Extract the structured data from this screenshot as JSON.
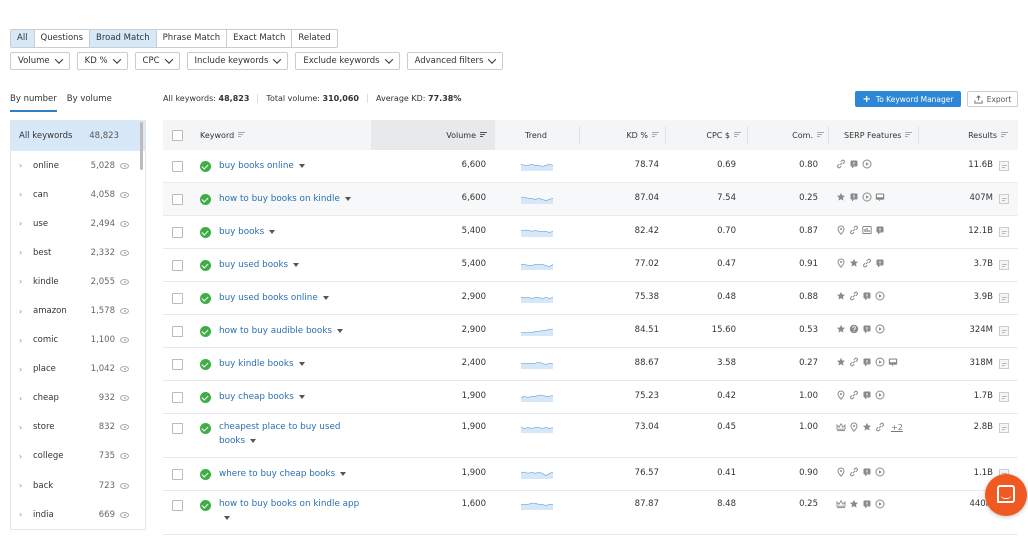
{
  "type_tabs": [
    {
      "label": "All",
      "active": true
    },
    {
      "label": "Questions",
      "active": false
    }
  ],
  "match_tabs": [
    {
      "label": "Broad Match",
      "active": true
    },
    {
      "label": "Phrase Match",
      "active": false
    },
    {
      "label": "Exact Match",
      "active": false
    },
    {
      "label": "Related",
      "active": false
    }
  ],
  "filters": [
    "Volume",
    "KD %",
    "CPC",
    "Include keywords",
    "Exclude keywords",
    "Advanced filters"
  ],
  "sidebar": {
    "tabs": [
      {
        "label": "By number",
        "active": true
      },
      {
        "label": "By volume",
        "active": false
      }
    ],
    "all": {
      "label": "All keywords",
      "count": "48,823"
    },
    "groups": [
      {
        "label": "online",
        "count": "5,028"
      },
      {
        "label": "can",
        "count": "4,058"
      },
      {
        "label": "use",
        "count": "2,494"
      },
      {
        "label": "best",
        "count": "2,332"
      },
      {
        "label": "kindle",
        "count": "2,055"
      },
      {
        "label": "amazon",
        "count": "1,578"
      },
      {
        "label": "comic",
        "count": "1,100"
      },
      {
        "label": "place",
        "count": "1,042"
      },
      {
        "label": "cheap",
        "count": "932"
      },
      {
        "label": "store",
        "count": "832"
      },
      {
        "label": "college",
        "count": "735"
      },
      {
        "label": "back",
        "count": "723"
      },
      {
        "label": "india",
        "count": "669"
      }
    ]
  },
  "stats": {
    "all_keywords_label": "All keywords:",
    "all_keywords_value": "48,823",
    "total_volume_label": "Total volume:",
    "total_volume_value": "310,060",
    "avg_kd_label": "Average KD:",
    "avg_kd_value": "77.38%"
  },
  "actions": {
    "keyword_manager": "To Keyword Manager",
    "export": "Export"
  },
  "columns": {
    "keyword": "Keyword",
    "volume": "Volume",
    "trend": "Trend",
    "kd": "KD %",
    "cpc": "CPC $",
    "com": "Com.",
    "serp": "SERP Features",
    "results": "Results"
  },
  "rows": [
    {
      "keyword": "buy books online",
      "volume": "6,600",
      "kd": "78.74",
      "cpc": "0.69",
      "com": "0.80",
      "serp": [
        "link",
        "review",
        "video"
      ],
      "results": "11.6B",
      "trend": [
        6,
        5,
        5,
        6,
        5,
        5,
        4,
        5,
        6,
        5
      ]
    },
    {
      "keyword": "how to buy books on kindle",
      "volume": "6,600",
      "kd": "87.04",
      "cpc": "7.54",
      "com": "0.25",
      "serp": [
        "star",
        "review",
        "video",
        "image"
      ],
      "results": "407M",
      "trend": [
        6,
        6,
        5,
        5,
        4,
        5,
        4,
        3,
        4,
        5
      ]
    },
    {
      "keyword": "buy books",
      "volume": "5,400",
      "kd": "82.42",
      "cpc": "0.70",
      "com": "0.87",
      "serp": [
        "pin",
        "link",
        "image-pack",
        "review"
      ],
      "results": "12.1B",
      "trend": [
        6,
        6,
        6,
        5,
        6,
        5,
        5,
        5,
        4,
        5
      ]
    },
    {
      "keyword": "buy used books",
      "volume": "5,400",
      "kd": "77.02",
      "cpc": "0.47",
      "com": "0.91",
      "serp": [
        "pin",
        "star",
        "link",
        "review"
      ],
      "results": "3.7B",
      "trend": [
        5,
        5,
        4,
        4,
        5,
        5,
        5,
        4,
        3,
        5
      ]
    },
    {
      "keyword": "buy used books online",
      "volume": "2,900",
      "kd": "75.38",
      "cpc": "0.48",
      "com": "0.88",
      "serp": [
        "star",
        "link",
        "review",
        "video"
      ],
      "results": "3.9B",
      "trend": [
        5,
        5,
        5,
        4,
        5,
        5,
        4,
        5,
        4,
        5
      ]
    },
    {
      "keyword": "how to buy audible books",
      "volume": "2,900",
      "kd": "84.51",
      "cpc": "15.60",
      "com": "0.53",
      "serp": [
        "star",
        "question",
        "review",
        "video"
      ],
      "results": "324M",
      "trend": [
        3,
        3,
        3,
        3,
        4,
        4,
        5,
        5,
        6,
        6
      ]
    },
    {
      "keyword": "buy kindle books",
      "volume": "2,400",
      "kd": "88.67",
      "cpc": "3.58",
      "com": "0.27",
      "serp": [
        "star",
        "link",
        "review",
        "video",
        "image"
      ],
      "results": "318M",
      "trend": [
        5,
        5,
        5,
        5,
        5,
        6,
        5,
        4,
        5,
        5
      ]
    },
    {
      "keyword": "buy cheap books",
      "volume": "1,900",
      "kd": "75.23",
      "cpc": "0.42",
      "com": "1.00",
      "serp": [
        "pin",
        "link",
        "review",
        "video"
      ],
      "results": "1.7B",
      "trend": [
        4,
        5,
        4,
        5,
        5,
        6,
        6,
        5,
        5,
        6
      ]
    },
    {
      "keyword": "cheapest place to buy used books",
      "volume": "1,900",
      "kd": "73.04",
      "cpc": "0.45",
      "com": "1.00",
      "serp": [
        "crown",
        "pin",
        "star",
        "link"
      ],
      "serp_more": "+2",
      "results": "2.8B",
      "trend": [
        5,
        4,
        5,
        4,
        5,
        5,
        4,
        5,
        4,
        5
      ]
    },
    {
      "keyword": "where to buy cheap books",
      "volume": "1,900",
      "kd": "76.57",
      "cpc": "0.41",
      "com": "0.90",
      "serp": [
        "pin",
        "link",
        "review",
        "video"
      ],
      "results": "1.1B",
      "trend": [
        6,
        6,
        5,
        6,
        5,
        6,
        5,
        3,
        5,
        6
      ]
    },
    {
      "keyword": "how to buy books on kindle app",
      "volume": "1,600",
      "kd": "87.87",
      "cpc": "8.48",
      "com": "0.25",
      "serp": [
        "crown",
        "star",
        "review",
        "video"
      ],
      "results": "440M",
      "trend": [
        5,
        5,
        5,
        6,
        6,
        5,
        5,
        4,
        5,
        5
      ]
    }
  ],
  "colors": {
    "accent": "#2d87d6",
    "link": "#2a6fb0",
    "ok": "#3fad46",
    "chat": "#f05a22",
    "selected_bg": "#d7e9f9"
  }
}
